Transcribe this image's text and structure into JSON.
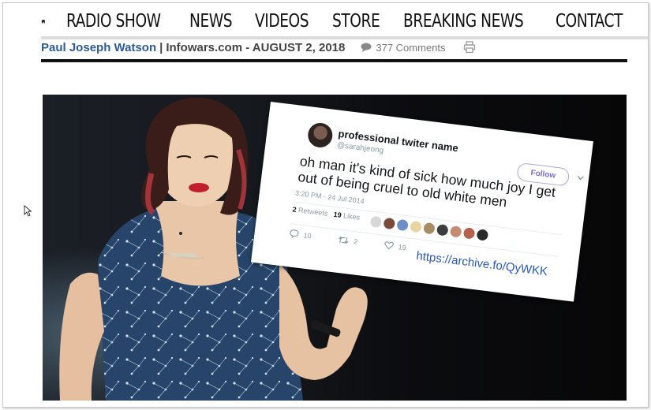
{
  "nav": {
    "home_icon": "home-icon",
    "items": [
      "RADIO SHOW",
      "NEWS",
      "VIDEOS",
      "STORE",
      "BREAKING NEWS",
      "CONTACT"
    ]
  },
  "byline": {
    "author": "Paul Joseph Watson",
    "separator": "|",
    "site_date": "Infowars.com - AUGUST 2, 2018",
    "comments": "377 Comments",
    "comment_icon": "speech-bubble-icon",
    "print_icon": "printer-icon"
  },
  "tweet": {
    "name": "professional twiter name",
    "handle": "@sarahjeong",
    "follow_label": "Follow",
    "text": "oh man it's kind of sick how much joy I get out of being cruel to old white men",
    "time": "3:20 PM - 24 Jul 2014",
    "retweets_count": "2",
    "retweets_label": "Retweets",
    "likes_count": "19",
    "likes_label": "Likes",
    "replies": "10",
    "retweets": "2",
    "likes": "19",
    "archive_link": "https://archive.fo/QyWKK"
  },
  "colors": {
    "author": "#2d5a98",
    "link": "#2b57b8",
    "follow": "#7b6cc4"
  }
}
